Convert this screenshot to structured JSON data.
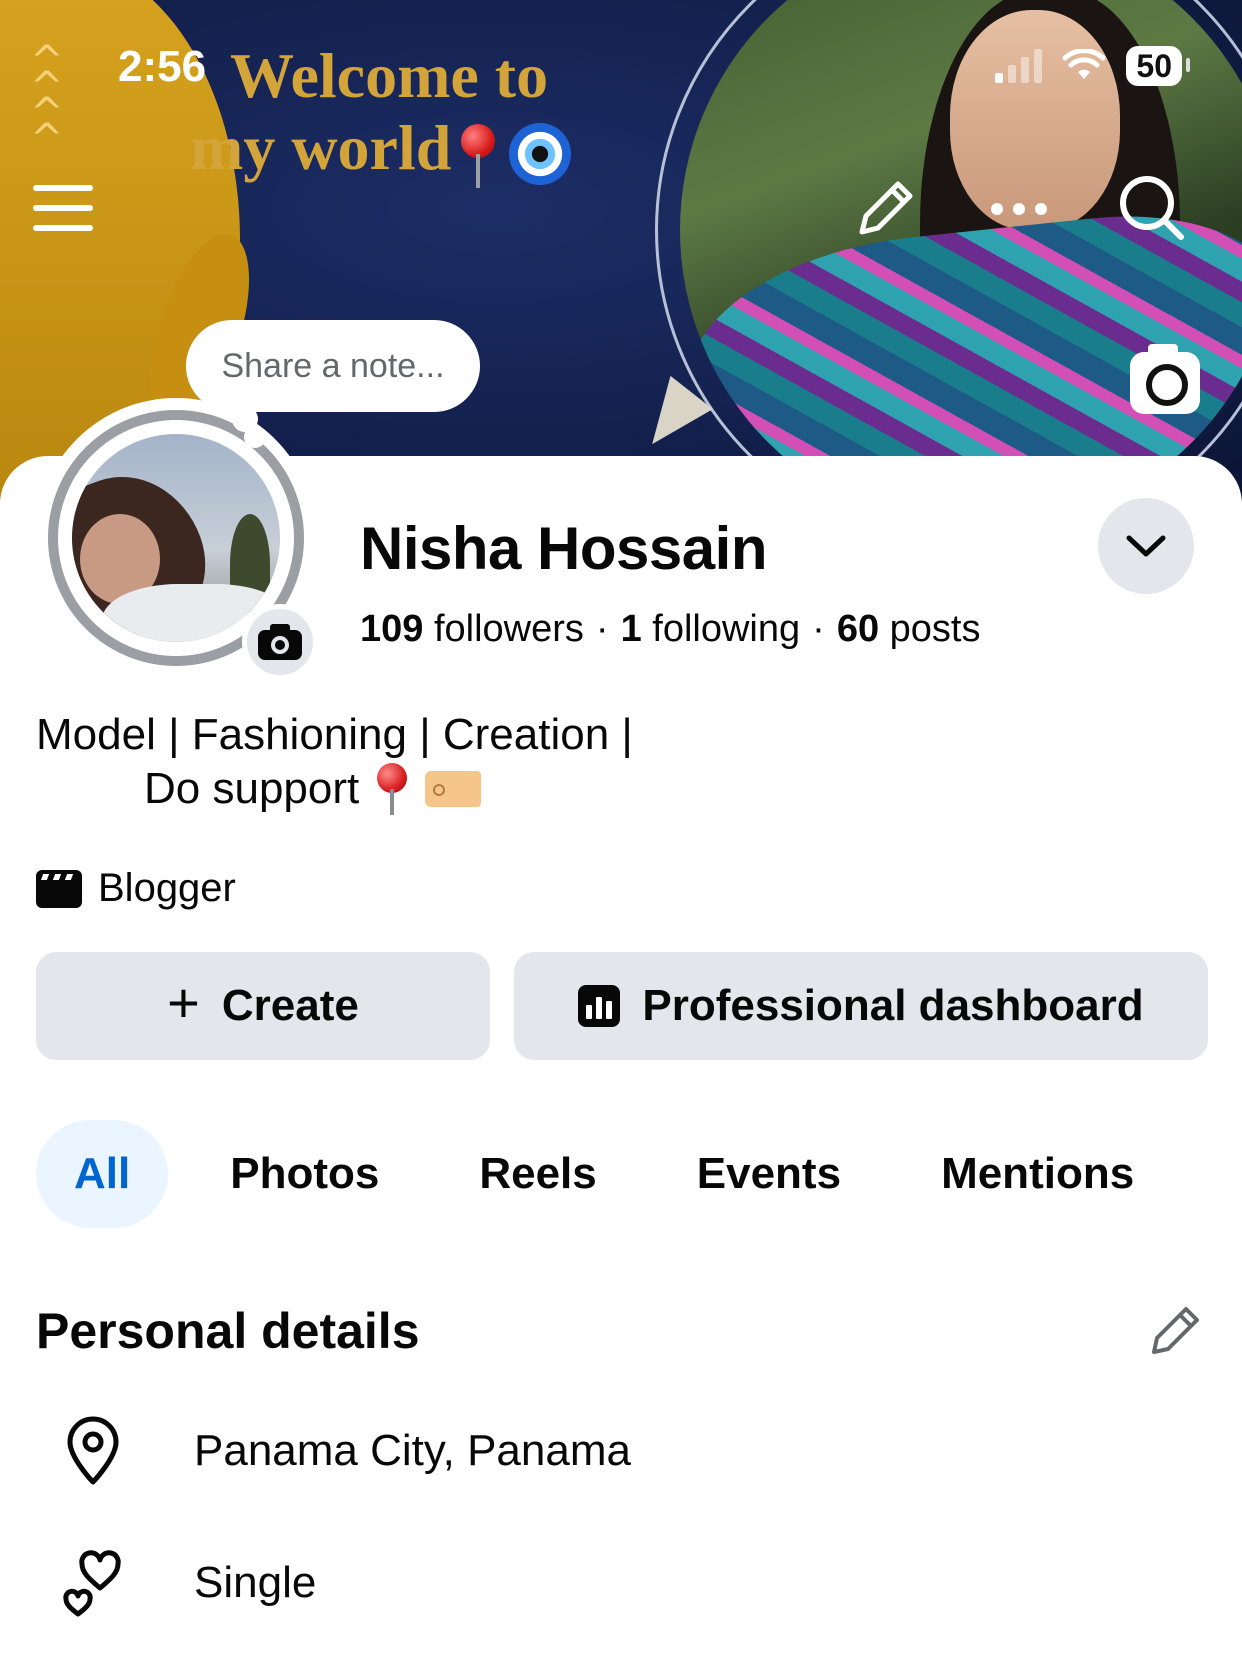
{
  "status_bar": {
    "time": "2:56",
    "battery": "50"
  },
  "cover": {
    "headline_line1": "Welcome to",
    "headline_line2": "my world",
    "note_placeholder": "Share a note..."
  },
  "profile": {
    "name": "Nisha Hossain",
    "followers_count": "109",
    "followers_label": "followers",
    "following_count": "1",
    "following_label": "following",
    "posts_count": "60",
    "posts_label": "posts",
    "bio_line1": "Model | Fashioning | Creation |",
    "bio_line2": "Do support",
    "category": "Blogger"
  },
  "actions": {
    "create_label": "Create",
    "dashboard_label": "Professional dashboard"
  },
  "tabs": [
    {
      "label": "All",
      "active": true
    },
    {
      "label": "Photos"
    },
    {
      "label": "Reels"
    },
    {
      "label": "Events"
    },
    {
      "label": "Mentions"
    }
  ],
  "personal_details": {
    "title": "Personal details",
    "location": "Panama City, Panama",
    "relationship": "Single"
  },
  "colors": {
    "accent": "#0064d1",
    "active_tab_bg": "#ebf5ff",
    "button_bg": "#e4e6eb",
    "text": "#080809"
  }
}
